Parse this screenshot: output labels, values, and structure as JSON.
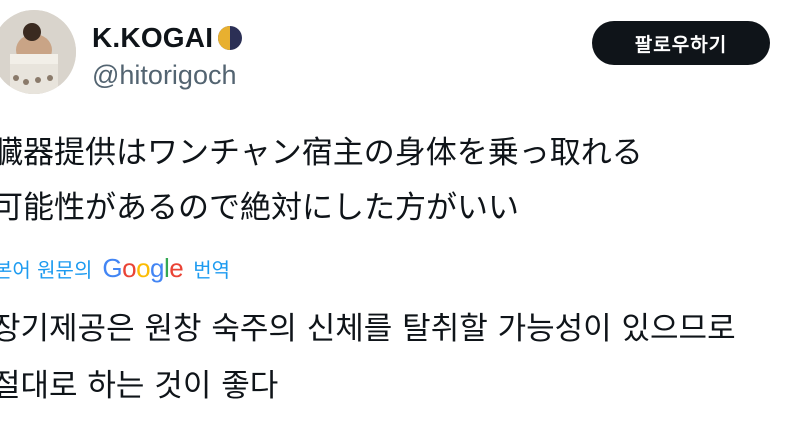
{
  "author": {
    "display_name": "K.KOGAI",
    "handle": "@hitorigoch",
    "name_badge": "moon-icon"
  },
  "follow_button": {
    "label": "팔로우하기"
  },
  "tweet": {
    "original_lines": [
      "臓器提供はワンチャン宿主の身体を乗っ取れる",
      "可能性があるので絶対にした方がいい"
    ],
    "translate": {
      "prefix": "본어 원문의",
      "provider": "Google",
      "suffix": "번역"
    },
    "translated_lines": [
      "장기제공은 원창 숙주의 신체를 탈취할 가능성이 있으므로",
      "절대로 하는 것이 좋다"
    ]
  },
  "colors": {
    "link_blue": "#1d9bf0",
    "text_primary": "#0f1419",
    "text_secondary": "#536471",
    "button_bg": "#0f1419"
  }
}
